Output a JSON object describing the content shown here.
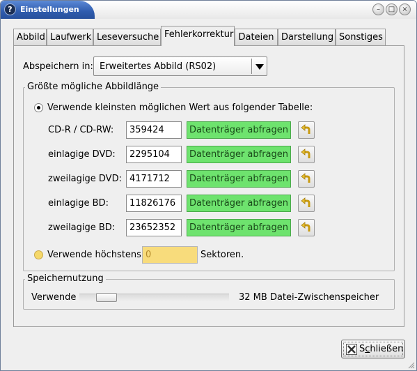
{
  "window": {
    "title": "Einstellungen",
    "app_icon_glyph": "?",
    "buttons": [
      "minimize-icon",
      "maximize-icon",
      "close-icon"
    ]
  },
  "tabs": [
    {
      "label": "Abbild",
      "active": false
    },
    {
      "label": "Laufwerk",
      "active": false
    },
    {
      "label": "Leseversuche",
      "active": false
    },
    {
      "label": "Fehlerkorrektur",
      "active": true
    },
    {
      "label": "Dateien",
      "active": false
    },
    {
      "label": "Darstellung",
      "active": false
    },
    {
      "label": "Sonstiges",
      "active": false
    }
  ],
  "save_in": {
    "label": "Abspeichern in:",
    "selected": "Erweitertes Abbild (RS02)"
  },
  "size_group": {
    "title": "Größte mögliche Abbildlänge",
    "option_table_label": "Verwende kleinsten möglichen Wert aus folgender Tabelle:",
    "rows": [
      {
        "label": "CD-R / CD-RW:",
        "value": "359424",
        "query": "Datenträger abfragen"
      },
      {
        "label": "einlagige DVD:",
        "value": "2295104",
        "query": "Datenträger abfragen"
      },
      {
        "label": "zweilagige DVD:",
        "value": "4171712",
        "query": "Datenträger abfragen"
      },
      {
        "label": "einlagige BD:",
        "value": "11826176",
        "query": "Datenträger abfragen"
      },
      {
        "label": "zweilagige BD:",
        "value": "23652352",
        "query": "Datenträger abfragen"
      }
    ],
    "option_max_label": "Verwende höchstens",
    "max_value": "0",
    "max_unit": "Sektoren."
  },
  "memory_group": {
    "title": "Speichernutzung",
    "use_label": "Verwende",
    "slider_level": 0.13,
    "result_text": "32 MB Datei-Zwischenspeicher"
  },
  "close_button": {
    "label_prefix": "S",
    "label_mnemonic": "c",
    "label_rest": "hließen"
  },
  "colors": {
    "title_accent": "#2f5cae",
    "query_button": "#6ee36e",
    "sector_entry": "#f8dc7c"
  }
}
